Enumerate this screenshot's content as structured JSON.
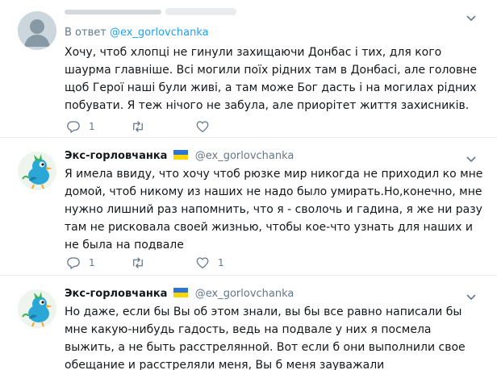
{
  "tweets": [
    {
      "reply_prefix": "В ответ",
      "reply_mention": "@ex_gorlovchanka",
      "text": "Хочу, чтоб хлопці не гинули захищаючи Донбас і тих, для кого шаурма главніше. Всі могили поїх рідних там в Донбасі, але головне щоб Герої наші були живі, а там може Бог дасть і на могилах рідних побувати. Я теж нічого не забула, але приорітет життя захисників.",
      "reply_count": "1",
      "retweet_count": "",
      "like_count": ""
    },
    {
      "author_name": "Экс-горловчанка",
      "author_handle": "@ex_gorlovchanka",
      "text": "Я имела ввиду, что хочу чтоб рюзке мир никогда не приходил ко мне домой, чтоб никому из наших не надо было умирать.Но,конечно, мне нужно лишний раз напомнить, что я - сволочь и гадина, я же ни разу там не рисковала своей жизнью, чтобы кое-что узнать для наших и не была на подвале",
      "reply_count": "1",
      "retweet_count": "",
      "like_count": "1"
    },
    {
      "author_name": "Экс-горловчанка",
      "author_handle": "@ex_gorlovchanka",
      "text": "Но даже, если бы Вы об этом знали, вы бы все равно написали бы мне какую-нибудь гадость, ведь на подвале у них я посмела выжить, а не быть расстрелянной. Вот если б они выполнили свое обещание и расстреляли меня, Вы б меня зауважали"
    }
  ],
  "icons": {
    "reply": "reply-icon",
    "retweet": "retweet-icon",
    "like": "heart-icon",
    "menu": "chevron-down-icon"
  },
  "colors": {
    "link": "#1da1f2",
    "muted": "#657786",
    "flag_blue": "#2f74d0",
    "flag_yellow": "#ffd400"
  }
}
